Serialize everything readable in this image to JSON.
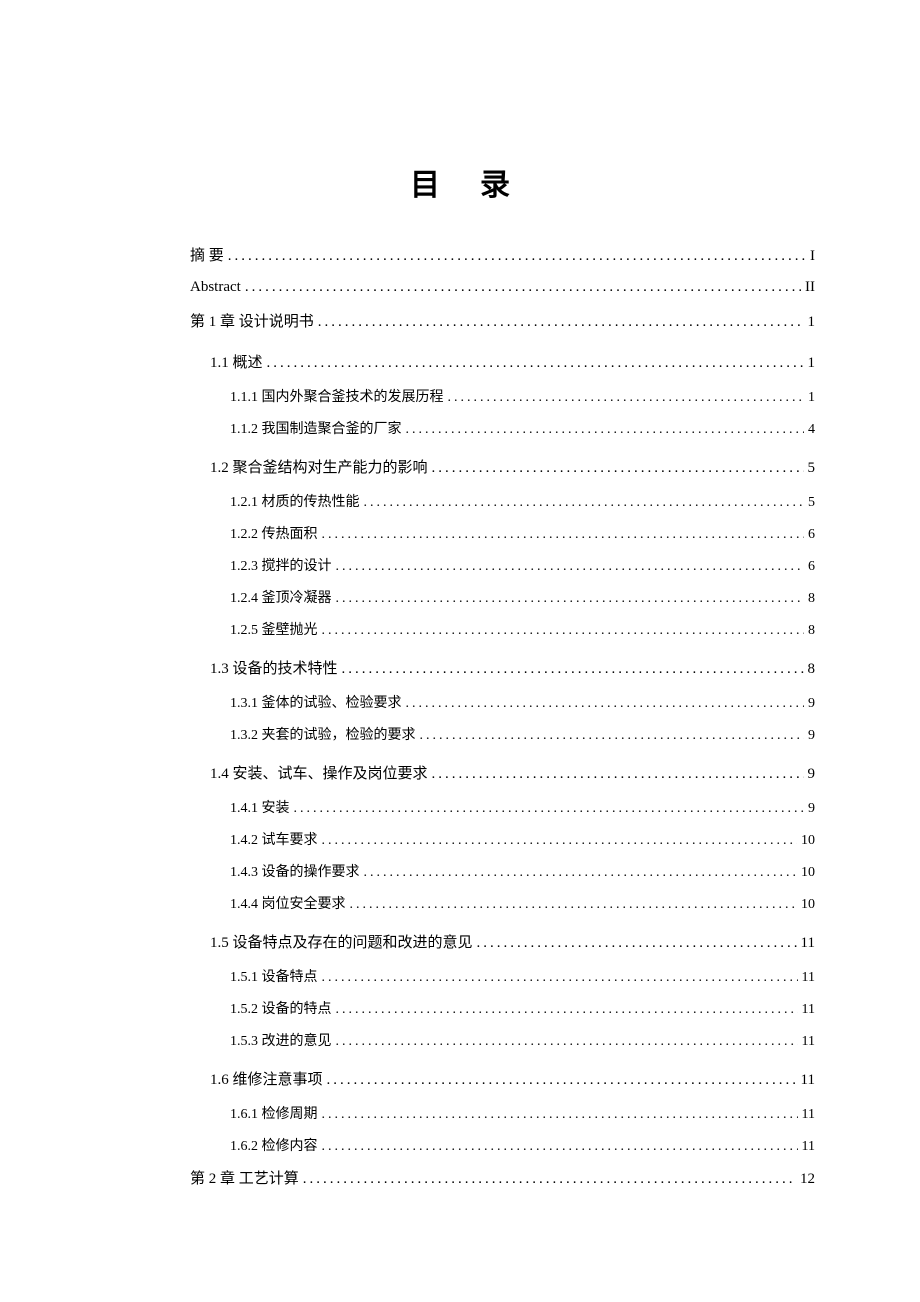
{
  "title": "目录",
  "dots": ".................................................................................................................................",
  "entries": [
    {
      "level": 0,
      "label": "摘    要",
      "page": "I",
      "spaced": false
    },
    {
      "level": 0,
      "label": "Abstract",
      "page": "II",
      "spaced": false
    },
    {
      "level": 0,
      "label": "第 1 章   设计说明书",
      "page": "1",
      "spaced": false
    },
    {
      "level": 1,
      "label": "1.1 概述",
      "page": "1",
      "spacerBefore": true
    },
    {
      "level": 2,
      "label": "1.1.1 国内外聚合釜技术的发展历程",
      "page": "1"
    },
    {
      "level": 2,
      "label": "1.1.2 我国制造聚合釜的厂家",
      "page": "4"
    },
    {
      "level": 1,
      "label": "1.2 聚合釜结构对生产能力的影响",
      "page": "5",
      "spacerBefore": true
    },
    {
      "level": 2,
      "label": "1.2.1 材质的传热性能",
      "page": "5"
    },
    {
      "level": 2,
      "label": "1.2.2 传热面积",
      "page": "6"
    },
    {
      "level": 2,
      "label": "1.2.3 搅拌的设计",
      "page": "6"
    },
    {
      "level": 2,
      "label": "1.2.4 釜顶冷凝器",
      "page": "8"
    },
    {
      "level": 2,
      "label": "1.2.5 釜壁抛光",
      "page": "8"
    },
    {
      "level": 1,
      "label": "1.3 设备的技术特性",
      "page": "8",
      "spacerBefore": true
    },
    {
      "level": 2,
      "label": "1.3.1 釜体的试验、检验要求",
      "page": "9"
    },
    {
      "level": 2,
      "label": "1.3.2 夹套的试验，检验的要求",
      "page": "9"
    },
    {
      "level": 1,
      "label": "1.4 安装、试车、操作及岗位要求",
      "page": "9",
      "spacerBefore": true
    },
    {
      "level": 2,
      "label": "1.4.1 安装",
      "page": "9"
    },
    {
      "level": 2,
      "label": "1.4.2 试车要求",
      "page": "10"
    },
    {
      "level": 2,
      "label": "1.4.3 设备的操作要求",
      "page": "10"
    },
    {
      "level": 2,
      "label": "1.4.4 岗位安全要求",
      "page": "10"
    },
    {
      "level": 1,
      "label": "1.5 设备特点及存在的问题和改进的意见",
      "page": "11",
      "spacerBefore": true
    },
    {
      "level": 2,
      "label": "1.5.1 设备特点",
      "page": "11"
    },
    {
      "level": 2,
      "label": "1.5.2 设备的特点",
      "page": "11"
    },
    {
      "level": 2,
      "label": "1.5.3 改进的意见",
      "page": "11"
    },
    {
      "level": 1,
      "label": "1.6 维修注意事项",
      "page": "11",
      "spacerBefore": true
    },
    {
      "level": 2,
      "label": "1.6.1 检修周期",
      "page": "11"
    },
    {
      "level": 2,
      "label": "1.6.2 检修内容",
      "page": "11"
    },
    {
      "level": 0,
      "label": "第 2 章   工艺计算",
      "page": "12",
      "spaced": false
    }
  ]
}
